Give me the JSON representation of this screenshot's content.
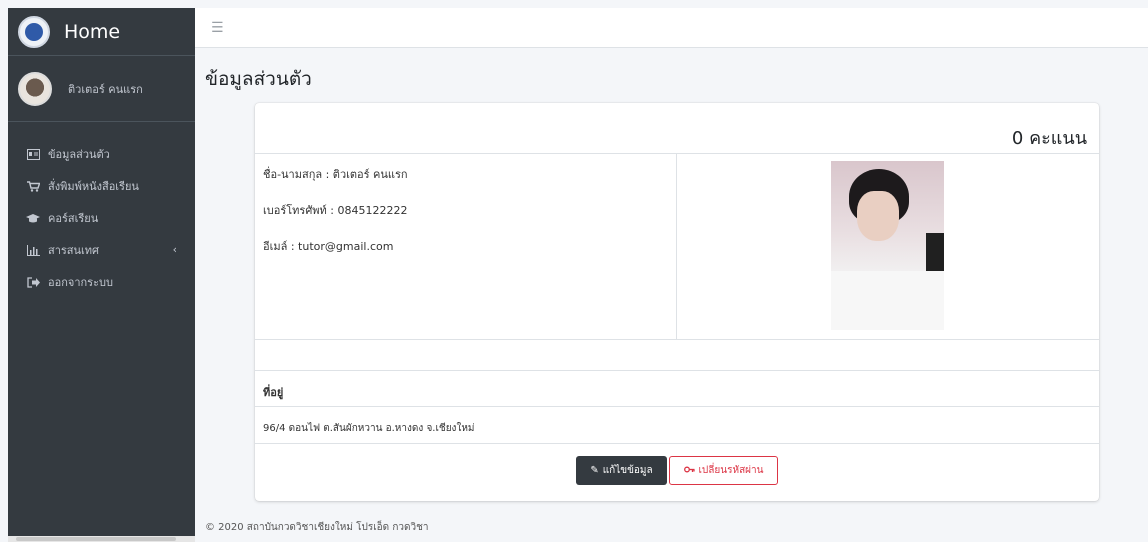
{
  "brand": {
    "title": "Home",
    "logo_icon": "school-logo-icon"
  },
  "user": {
    "name": "ติวเตอร์ คนแรก"
  },
  "sidebar": {
    "items": [
      {
        "label": "ข้อมูลส่วนตัว",
        "icon": "id-card-icon"
      },
      {
        "label": "สั่งพิมพ์หนังสือเรียน",
        "icon": "cart-icon"
      },
      {
        "label": "คอร์สเรียน",
        "icon": "graduation-cap-icon"
      },
      {
        "label": "สารสนเทศ",
        "icon": "chart-icon"
      },
      {
        "label": "ออกจากระบบ",
        "icon": "sign-out-icon"
      }
    ]
  },
  "page": {
    "title": "ข้อมูลส่วนตัว"
  },
  "profile": {
    "score": "0 คะแนน",
    "name_line": "ชื่อ-นามสกุล : ติวเตอร์ คนแรก",
    "phone_line": "เบอร์โทรศัพท์ : 0845122222",
    "email_line": "อีเมล์ : tutor@gmail.com",
    "address_title": "ที่อยู่",
    "address": "96/4 ดอนไฟ ต.สันผักหวาน อ.หางดง จ.เชียงใหม่"
  },
  "buttons": {
    "edit": "แก้ไขข้อมูล",
    "change_password": "เปลี่ยนรหัสผ่าน"
  },
  "footer": {
    "text": "© 2020 สถาบันกวดวิชาเชียงใหม่ โปรเอ็ด กวดวิชา"
  },
  "colors": {
    "sidebar": "#343a40",
    "danger": "#dc3545",
    "background": "#f4f6f9"
  }
}
